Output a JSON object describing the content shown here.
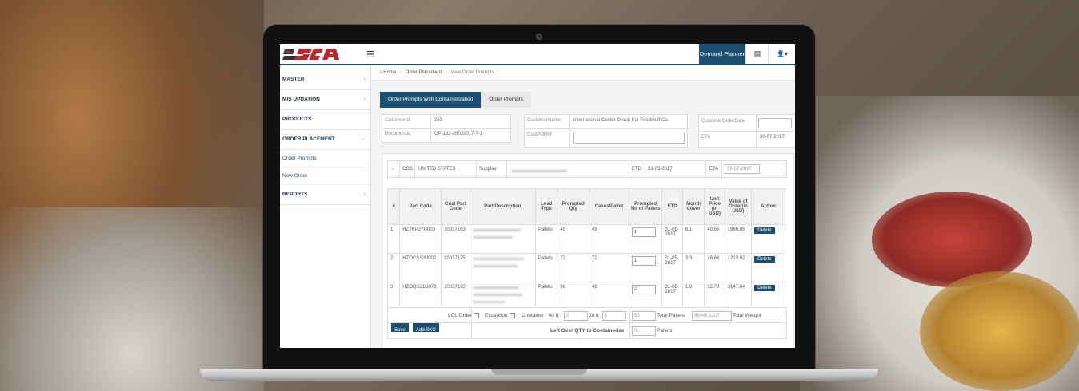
{
  "header": {
    "role_button": "Demand Planner"
  },
  "sidebar": {
    "items": [
      {
        "label": "MASTER"
      },
      {
        "label": "MIS UPDATION"
      },
      {
        "label": "PRODUCTS"
      },
      {
        "label": "ORDER PLACEMENT"
      }
    ],
    "sub_items": [
      {
        "label": "Order Prompts"
      },
      {
        "label": "New Order"
      }
    ],
    "reports": "REPORTS"
  },
  "breadcrumb": {
    "home": "Home",
    "section": "Order Placement",
    "current": "View Order Prompts"
  },
  "tabs": [
    {
      "label": "Order Prompts With Containerization"
    },
    {
      "label": "Order Prompts"
    }
  ],
  "info": {
    "customer_id_label": "CustomerId",
    "customer_id": "263",
    "document_id_label": "DocumentId",
    "document_id": "OP-132-28032017-7-1",
    "customer_name_label": "CustomerName",
    "customer_name": "International Center Group For Foodstuff Co.",
    "cust_po_ref_label": "CustPORef",
    "customer_order_date_label": "CustomerOrderDate",
    "eta_label": "ETA",
    "eta": "30-07-2017"
  },
  "strip": {
    "cos_label": "COS",
    "cos": "UNITED STATES",
    "supplier_label": "Supplier",
    "etd_label": "ETD",
    "etd": "31-05-2017",
    "eta_label": "ETA",
    "eta_input": "25-07-2017"
  },
  "table": {
    "headers": [
      "#",
      "Part Code",
      "Cust Part Code",
      "Part Description",
      "Load Type",
      "Prompted Qty",
      "Cases/Pallet",
      "Prompted No of Pallets",
      "ETD",
      "Month Cover",
      "Unit Price (in USD)",
      "Value of Order(in USD)",
      "Action"
    ],
    "rows": [
      {
        "n": "1",
        "part_code": "HZTKP27U003",
        "cust_part": "10037163",
        "load": "Pallets",
        "qty": "49",
        "cases": "49",
        "pallets": "1",
        "etd": "31-05-2017",
        "cover": "6.1",
        "price": "40.55",
        "value": "1986.95",
        "action": "Delete"
      },
      {
        "n": "2",
        "part_code": "HZOCS12U002",
        "cust_part": "10037175",
        "load": "Pallets",
        "qty": "72",
        "cases": "72",
        "pallets": "1",
        "etd": "31-05-2017",
        "cover": "3.3",
        "price": "16.86",
        "value": "1213.92",
        "action": "Delete"
      },
      {
        "n": "3",
        "part_code": "HZOQS21U078",
        "cust_part": "10037195",
        "load": "Pallets",
        "qty": "96",
        "cases": "48",
        "pallets": "2",
        "etd": "31-05-2017",
        "cover": "1.9",
        "price": "32.79",
        "value": "3147.84",
        "action": "Delete"
      }
    ]
  },
  "footer": {
    "lcl_label": "LCL Order",
    "exception_label": "Exception",
    "container40_label": "Container : 40 ft",
    "container40": "2",
    "container20_label": "20 ft",
    "container20": "1",
    "total_pallets_value": "50",
    "total_pallets_label": "Total Pallets",
    "total_weight_value": "48446.1207",
    "total_weight_label": "Total Weight",
    "save": "Save",
    "add_sku": "Add SKU",
    "leftover_label": "Left Over QTY to Containerize",
    "leftover_value": "0",
    "leftover_unit": "Pallets"
  },
  "colors": {
    "accent": "#1b4f72",
    "logo_red": "#c0272d"
  }
}
